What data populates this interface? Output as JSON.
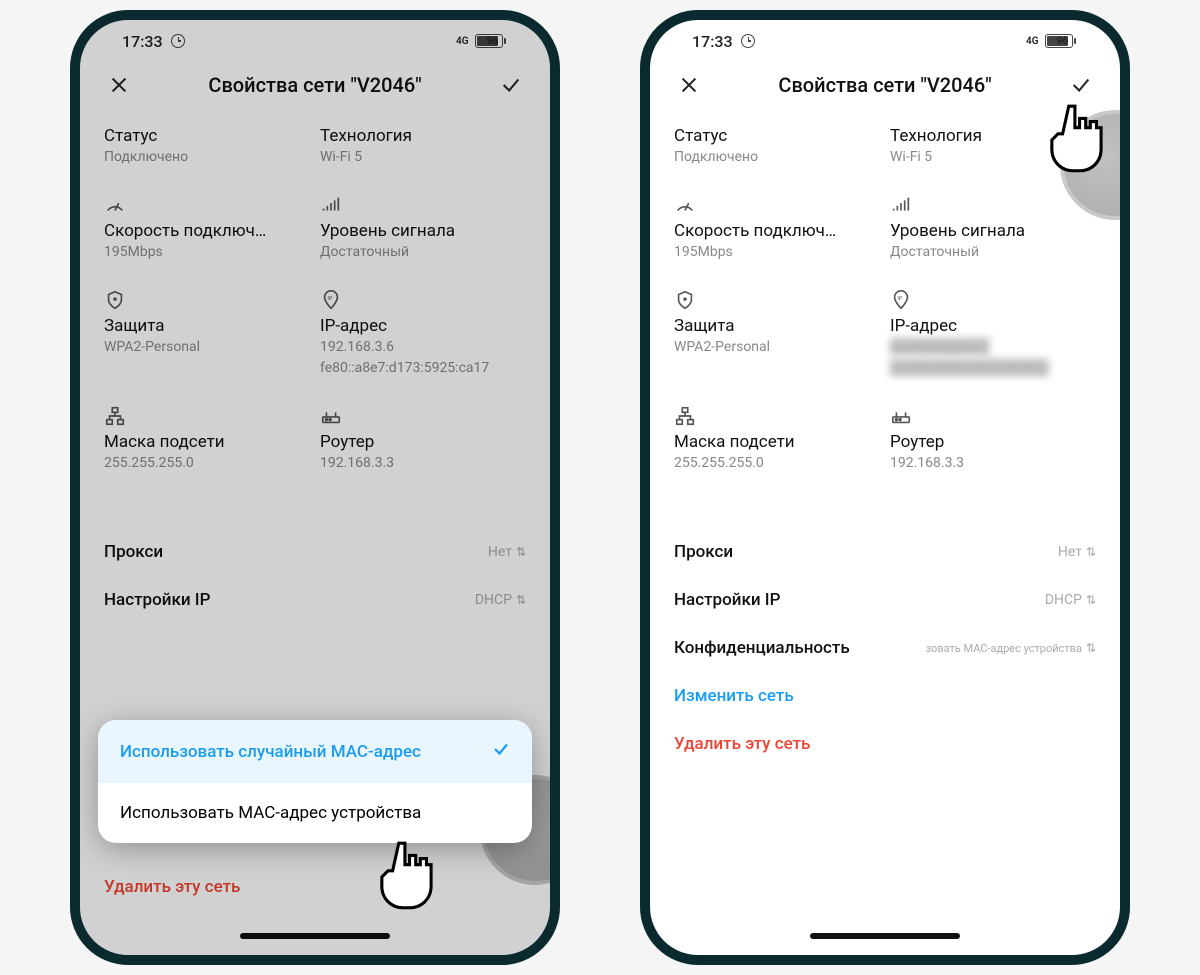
{
  "statusbar": {
    "time": "17:33",
    "net": "4G",
    "battery": "96"
  },
  "header": {
    "title": "Свойства сети \"V2046\""
  },
  "cells": {
    "status": {
      "label": "Статус",
      "value": "Подключено"
    },
    "tech": {
      "label": "Технология",
      "value": "Wi-Fi 5"
    },
    "speed": {
      "label": "Скорость подключ…",
      "value": "195Mbps"
    },
    "signal": {
      "label": "Уровень сигнала",
      "value": "Достаточный"
    },
    "security": {
      "label": "Защита",
      "value": "WPA2-Personal"
    },
    "ip": {
      "label": "IP-адрес",
      "value1": "192.168.3.6",
      "value2": "fe80::a8e7:d173:5925:ca17"
    },
    "subnet": {
      "label": "Маска подсети",
      "value": "255.255.255.0"
    },
    "router": {
      "label": "Роутер",
      "value": "192.168.3.3"
    }
  },
  "rows": {
    "proxy": {
      "label": "Прокси",
      "value": "Нет"
    },
    "ip_settings": {
      "label": "Настройки IP",
      "value": "DHCP"
    },
    "privacy": {
      "label": "Конфиденциальность",
      "value": "зовать MAC-адрес устройства"
    }
  },
  "links": {
    "edit": "Изменить сеть",
    "delete": "Удалить эту сеть"
  },
  "popup": {
    "opt1": "Использовать случайный MAC-адрес",
    "opt2": "Использовать MAC-адрес устройства"
  }
}
